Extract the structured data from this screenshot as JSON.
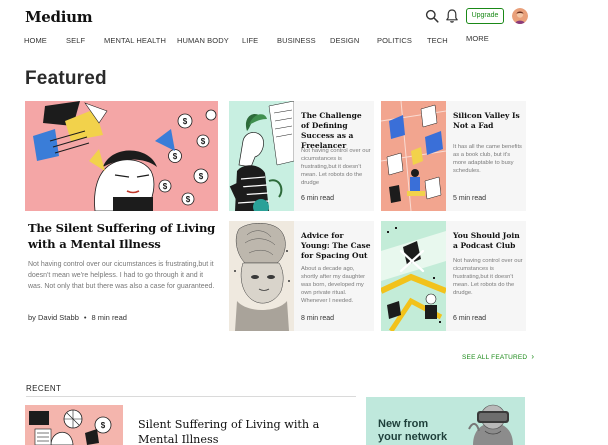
{
  "header": {
    "logo": "Medium",
    "upgrade_label": "Upgrade",
    "icons": [
      "search-icon",
      "bell-icon",
      "avatar"
    ]
  },
  "nav": {
    "items": [
      "HOME",
      "SELF",
      "MENTAL HEALTH",
      "HUMAN BODY",
      "LIFE",
      "BUSINESS",
      "DESIGN",
      "POLITICS",
      "TECH",
      "MORE"
    ]
  },
  "featured": {
    "title": "Featured",
    "hero": {
      "title": "The Silent Suffering of Living with a Mental Illness",
      "excerpt": "Not having control over our cicumstances is frustrating,but it doesn't mean we're helpless. I had to go through it and it was. Not only that but there was also a case for guaranteed.",
      "author": "by David Stabb",
      "read_time": "8 min read"
    },
    "cards": [
      {
        "title": "The Challenge of Defining Success as a Freelancer",
        "excerpt": "Not having control over our cicumstances is frustrating,but it doesn't mean. Let robots do the drudge",
        "read_time": "6 min read"
      },
      {
        "title": "Silicon Valley Is Not a Fad",
        "excerpt": "It has all the came benefits as a book club, but it's more adaptable to busy schedules.",
        "read_time": "5 min read"
      },
      {
        "title": "Advice for Young: The Case for Spacing Out",
        "excerpt": "About a decade ago, shortly after my daughter was born, developed my own private ritual. Whenever I needed.",
        "read_time": "8 min read"
      },
      {
        "title": "You Should Join a Podcast Club",
        "excerpt": "Not having control over our cicumstances is frustrating,but it doesn't mean. Let robots do the drudge.",
        "read_time": "6 min read"
      }
    ],
    "see_all_label": "SEE ALL FEATURED",
    "see_all_arrow": "›"
  },
  "recent": {
    "label": "RECENT",
    "first_title": "Silent Suffering of Living with a Mental Illness"
  },
  "promo": {
    "text_line1": "New from",
    "text_line2": "your network"
  },
  "colors": {
    "accent_green": "#1a8917",
    "hero_pink": "#f4a6a6",
    "card_bg": "#f6f6f6",
    "promo_bg": "#bfe8dc"
  }
}
